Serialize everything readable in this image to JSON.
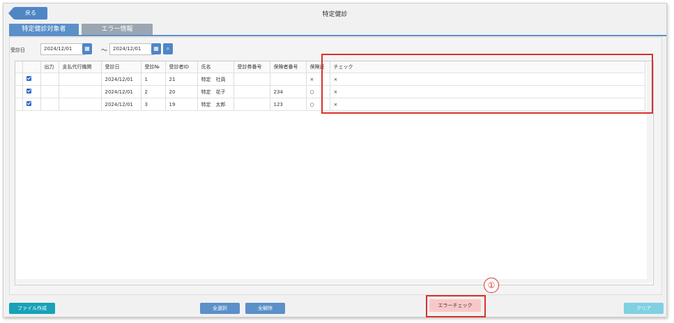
{
  "header": {
    "back_label": "戻る",
    "title": "特定健診"
  },
  "tabs": [
    {
      "label": "特定健診対象者",
      "active": true
    },
    {
      "label": "エラー情報",
      "active": false
    }
  ],
  "filter": {
    "label": "受診日",
    "date_from": "2024/12/01",
    "date_to": "2024/12/01",
    "separator": "～",
    "calendar_icon": "calendar-icon",
    "search_icon": "search-icon"
  },
  "table": {
    "columns": [
      "",
      "出力",
      "支払代行機関",
      "受診日",
      "受診№",
      "受診者ID",
      "氏名",
      "受診券番号",
      "保険者番号",
      "保険証",
      "チェック"
    ],
    "rows": [
      {
        "checked": true,
        "output": "",
        "agency": "",
        "date": "2024/12/01",
        "no": "1",
        "id": "21",
        "name": "特定　社員",
        "ticket": "",
        "insurer": "",
        "card": "×",
        "check": "×"
      },
      {
        "checked": true,
        "output": "",
        "agency": "",
        "date": "2024/12/01",
        "no": "2",
        "id": "20",
        "name": "特定　花子",
        "ticket": "",
        "insurer": "234",
        "card": "○",
        "check": "×"
      },
      {
        "checked": true,
        "output": "",
        "agency": "",
        "date": "2024/12/01",
        "no": "3",
        "id": "19",
        "name": "特定　太郎",
        "ticket": "",
        "insurer": "123",
        "card": "○",
        "check": "×"
      }
    ]
  },
  "footer": {
    "create_file": "ファイル作成",
    "select_all": "全選択",
    "deselect_all": "全解除",
    "error_check": "エラーチェック",
    "clear": "クリア"
  },
  "annotation": {
    "marker": "①"
  },
  "colors": {
    "primary": "#4f86c6",
    "teal": "#17a2b8",
    "highlight": "#d9312b"
  }
}
